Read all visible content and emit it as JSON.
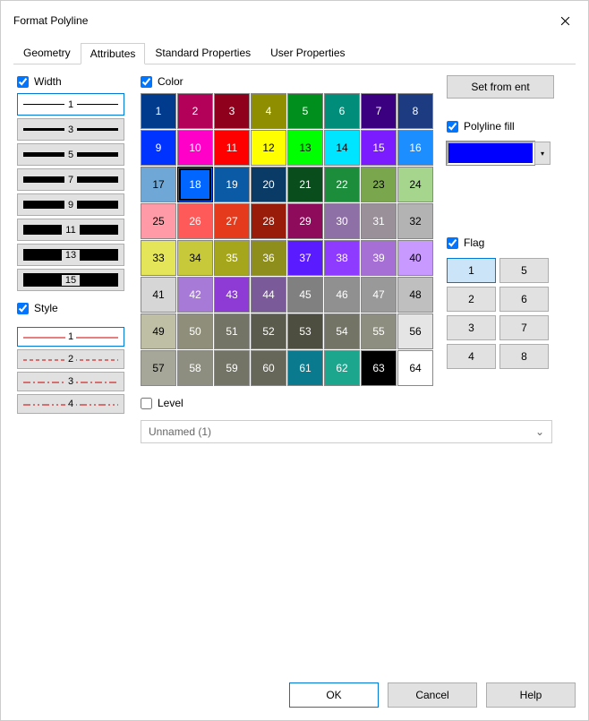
{
  "window": {
    "title": "Format Polyline"
  },
  "tabs": [
    "Geometry",
    "Attributes",
    "Standard Properties",
    "User Properties"
  ],
  "active_tab": 1,
  "width": {
    "label": "Width",
    "checked": true,
    "items": [
      1,
      3,
      5,
      7,
      9,
      11,
      13,
      15
    ],
    "selected": 0
  },
  "style": {
    "label": "Style",
    "checked": true,
    "items": [
      1,
      2,
      3,
      4
    ],
    "selected": 0
  },
  "color": {
    "label": "Color",
    "checked": true,
    "selected": 18,
    "swatches": [
      {
        "n": 1,
        "c": "#003b8e",
        "t": "dark"
      },
      {
        "n": 2,
        "c": "#b30059",
        "t": "dark"
      },
      {
        "n": 3,
        "c": "#8e001c",
        "t": "dark"
      },
      {
        "n": 4,
        "c": "#8e8e00",
        "t": "dark"
      },
      {
        "n": 5,
        "c": "#008e1c",
        "t": "dark"
      },
      {
        "n": 6,
        "c": "#008e7a",
        "t": "dark"
      },
      {
        "n": 7,
        "c": "#3b0080",
        "t": "dark"
      },
      {
        "n": 8,
        "c": "#1c3b80",
        "t": "dark"
      },
      {
        "n": 9,
        "c": "#0033ff",
        "t": "dark"
      },
      {
        "n": 10,
        "c": "#ff00c8",
        "t": "dark"
      },
      {
        "n": 11,
        "c": "#ff0000",
        "t": "dark"
      },
      {
        "n": 12,
        "c": "#ffff00",
        "t": "light"
      },
      {
        "n": 13,
        "c": "#00ff00",
        "t": "light"
      },
      {
        "n": 14,
        "c": "#00e5ff",
        "t": "light"
      },
      {
        "n": 15,
        "c": "#7a1cff",
        "t": "dark"
      },
      {
        "n": 16,
        "c": "#1c8eff",
        "t": "dark"
      },
      {
        "n": 17,
        "c": "#6fa8d6",
        "t": "light"
      },
      {
        "n": 18,
        "c": "#0066ff",
        "t": "dark"
      },
      {
        "n": 19,
        "c": "#0a5aa6",
        "t": "dark"
      },
      {
        "n": 20,
        "c": "#0a3b66",
        "t": "dark"
      },
      {
        "n": 21,
        "c": "#0a4d1c",
        "t": "dark"
      },
      {
        "n": 22,
        "c": "#1c8e3b",
        "t": "dark"
      },
      {
        "n": 23,
        "c": "#7aa64d",
        "t": "light"
      },
      {
        "n": 24,
        "c": "#a6d68e",
        "t": "light"
      },
      {
        "n": 25,
        "c": "#ff9aa6",
        "t": "light"
      },
      {
        "n": 26,
        "c": "#ff5a5a",
        "t": "dark"
      },
      {
        "n": 27,
        "c": "#e53b1c",
        "t": "dark"
      },
      {
        "n": 28,
        "c": "#991c0a",
        "t": "dark"
      },
      {
        "n": 29,
        "c": "#8e0a5a",
        "t": "dark"
      },
      {
        "n": 30,
        "c": "#8e6fa6",
        "t": "dark"
      },
      {
        "n": 31,
        "c": "#999099",
        "t": "dark"
      },
      {
        "n": 32,
        "c": "#b3b3b3",
        "t": "light"
      },
      {
        "n": 33,
        "c": "#e5e55a",
        "t": "light"
      },
      {
        "n": 34,
        "c": "#c8c83b",
        "t": "light"
      },
      {
        "n": 35,
        "c": "#a6a61c",
        "t": "dark"
      },
      {
        "n": 36,
        "c": "#8e8e1c",
        "t": "dark"
      },
      {
        "n": 37,
        "c": "#5a1cff",
        "t": "dark"
      },
      {
        "n": 38,
        "c": "#8e3bff",
        "t": "dark"
      },
      {
        "n": 39,
        "c": "#a66fd6",
        "t": "dark"
      },
      {
        "n": 40,
        "c": "#c89aff",
        "t": "light"
      },
      {
        "n": 41,
        "c": "#d6d6d6",
        "t": "light"
      },
      {
        "n": 42,
        "c": "#a67ad6",
        "t": "dark"
      },
      {
        "n": 43,
        "c": "#8e3bd6",
        "t": "dark"
      },
      {
        "n": 44,
        "c": "#7a5a99",
        "t": "dark"
      },
      {
        "n": 45,
        "c": "#808080",
        "t": "dark"
      },
      {
        "n": 46,
        "c": "#909090",
        "t": "dark"
      },
      {
        "n": 47,
        "c": "#999999",
        "t": "dark"
      },
      {
        "n": 48,
        "c": "#bfbfbf",
        "t": "light"
      },
      {
        "n": 49,
        "c": "#bfbfa6",
        "t": "light"
      },
      {
        "n": 50,
        "c": "#8e8e7a",
        "t": "dark"
      },
      {
        "n": 51,
        "c": "#737366",
        "t": "dark"
      },
      {
        "n": 52,
        "c": "#5a5a4d",
        "t": "dark"
      },
      {
        "n": 53,
        "c": "#4d4d40",
        "t": "dark"
      },
      {
        "n": 54,
        "c": "#737366",
        "t": "dark"
      },
      {
        "n": 55,
        "c": "#8e8e80",
        "t": "dark"
      },
      {
        "n": 56,
        "c": "#e5e5e5",
        "t": "light"
      },
      {
        "n": 57,
        "c": "#a6a699",
        "t": "light"
      },
      {
        "n": 58,
        "c": "#8e8e80",
        "t": "dark"
      },
      {
        "n": 59,
        "c": "#737366",
        "t": "dark"
      },
      {
        "n": 60,
        "c": "#666659",
        "t": "dark"
      },
      {
        "n": 61,
        "c": "#0a7a8e",
        "t": "dark"
      },
      {
        "n": 62,
        "c": "#1ca68e",
        "t": "dark"
      },
      {
        "n": 63,
        "c": "#000000",
        "t": "dark"
      },
      {
        "n": 64,
        "c": "#ffffff",
        "t": "light"
      }
    ]
  },
  "right": {
    "set_from_ent": "Set from ent",
    "polyline_fill_label": "Polyline fill",
    "polyline_fill_checked": true,
    "fill_color": "#0000ff",
    "flag_label": "Flag",
    "flag_checked": true,
    "flags": [
      1,
      2,
      3,
      4,
      5,
      6,
      7,
      8
    ],
    "flag_selected": 1
  },
  "level": {
    "label": "Level",
    "checked": false,
    "value": "Unnamed (1)"
  },
  "footer": {
    "ok": "OK",
    "cancel": "Cancel",
    "help": "Help"
  }
}
